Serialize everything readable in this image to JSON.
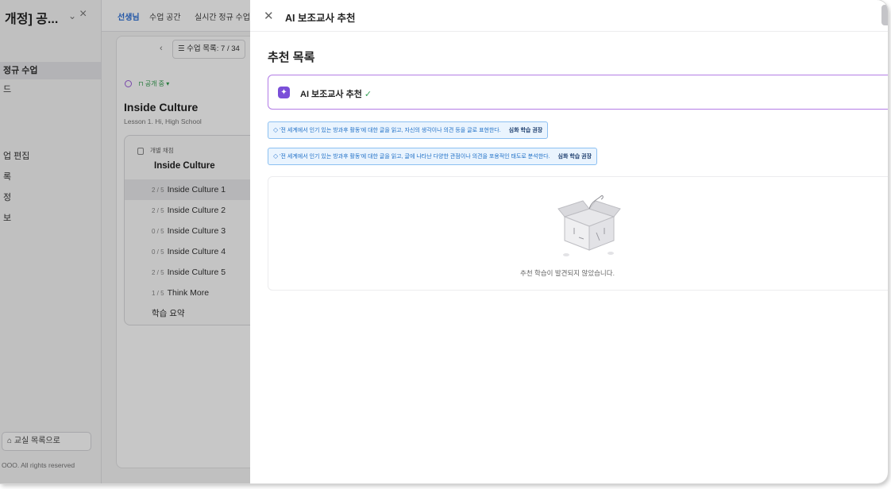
{
  "sidebar": {
    "title": "개정] 공...",
    "items": [
      {
        "label": "정규 수업",
        "active": true
      },
      {
        "label": "드",
        "active": false
      },
      {
        "label": "업 편집",
        "active": false
      },
      {
        "label": "록",
        "active": false
      },
      {
        "label": "정",
        "active": false
      },
      {
        "label": "보",
        "active": false
      }
    ],
    "back_button": "교실 목록으로",
    "footer": "OOO. All rights reserved"
  },
  "topbar": {
    "badge": "선생님",
    "crumb1": "수업 공간",
    "crumb2": "실시간 정규 수업"
  },
  "lesson_nav": {
    "list_label": "수업 목록: 7 / 34"
  },
  "lesson": {
    "status": "공개 중",
    "title": "Inside Culture",
    "subtitle": "Lesson 1. Hi, High School",
    "card_tag": "개별 채점",
    "card_title": "Inside Culture",
    "rows": [
      {
        "count": "2 / 5",
        "label": "Inside Culture 1",
        "active": true
      },
      {
        "count": "2 / 5",
        "label": "Inside Culture 2",
        "active": false
      },
      {
        "count": "0 / 5",
        "label": "Inside Culture 3",
        "active": false
      },
      {
        "count": "0 / 5",
        "label": "Inside Culture 4",
        "active": false
      },
      {
        "count": "2 / 5",
        "label": "Inside Culture 5",
        "active": false
      },
      {
        "count": "1 / 5",
        "label": "Think More",
        "active": false
      },
      {
        "count": "",
        "label": "학습 요약",
        "active": false
      }
    ]
  },
  "drawer": {
    "title": "AI 보조교사 추천",
    "heading": "추천 목록",
    "ai_label": "AI 보조교사 추천",
    "ai_check": "✓",
    "tags": [
      {
        "text": "'전 세계에서 인기 있는 방과후 활동'에 대한 글을 읽고, 자신의 생각이나 의견 등을 글로 표현한다.",
        "recommend": "심화 학습 권장"
      },
      {
        "text": "'전 세계에서 인기 있는 방과후 활동'에 대한 글을 읽고, 글에 나타난 다양한 관점이나 의견을 포용적인 태도로 분석한다.",
        "recommend": "심화 학습 권장"
      }
    ],
    "empty_text": "추천 학습이 발견되지 않았습니다."
  },
  "colors": {
    "accent_purple": "#b37de6",
    "tag_blue": "#8cc0f2",
    "badge_blue": "#2b6fd6"
  }
}
